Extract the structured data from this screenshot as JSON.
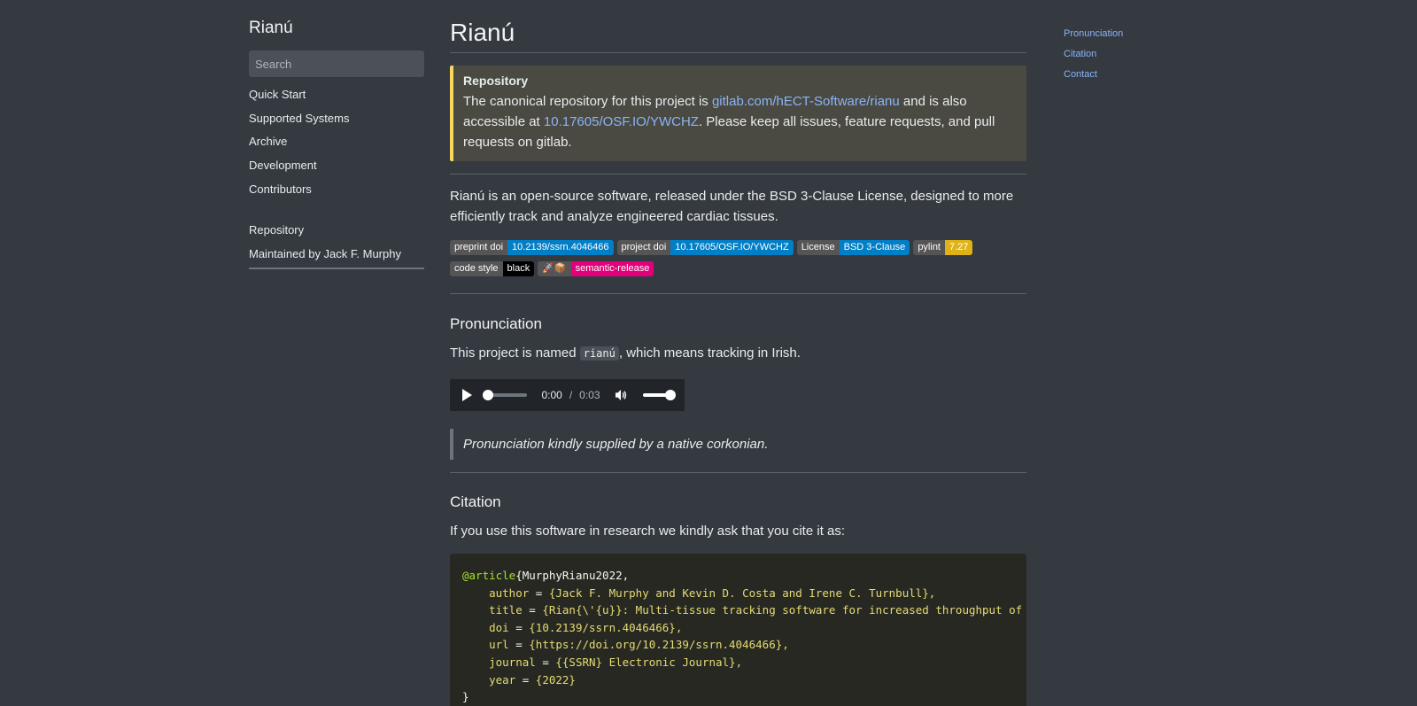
{
  "sidebar": {
    "title": "Rianú",
    "search_placeholder": "Search",
    "nav": [
      "Quick Start",
      "Supported Systems",
      "Archive",
      "Development",
      "Contributors"
    ],
    "links": [
      "Repository",
      "Maintained by Jack F. Murphy"
    ]
  },
  "main": {
    "title": "Rianú",
    "admonition": {
      "title": "Repository",
      "text_1": "The canonical repository for this project is ",
      "link_1": "gitlab.com/hECT-Software/rianu",
      "text_2": " and is also accessible at ",
      "link_2": "10.17605/OSF.IO/YWCHZ",
      "text_3": ". Please keep all issues, feature requests, and pull requests on gitlab."
    },
    "intro": "Rianú is an open-source software, released under the BSD 3-Clause License, designed to more efficiently track and analyze engineered cardiac tissues.",
    "badges": [
      {
        "label": "preprint doi",
        "value": "10.2139/ssrn.4046466",
        "color": "#007ec6"
      },
      {
        "label": "project doi",
        "value": "10.17605/OSF.IO/YWCHZ",
        "color": "#007ec6"
      },
      {
        "label": "License",
        "value": "BSD 3-Clause",
        "color": "#007ec6"
      },
      {
        "label": "pylint",
        "value": "7.27",
        "color": "#dfb317"
      },
      {
        "label": "code style",
        "value": "black",
        "color": "#000000"
      },
      {
        "label": "🚀📦",
        "value": "semantic-release",
        "color": "#e10079"
      }
    ],
    "pronunciation": {
      "heading": "Pronunciation",
      "text_before": "This project is named ",
      "code": "rianú",
      "text_after": ", which means tracking in Irish.",
      "audio": {
        "current": "0:00",
        "separator": "/",
        "duration": "0:03",
        "progress": 0,
        "volume": 1
      },
      "quote": "Pronunciation kindly supplied by a native corkonian."
    },
    "citation": {
      "heading": "Citation",
      "text": "If you use this software in research we kindly ask that you cite it as:",
      "entry_type": "@article",
      "entry_key": "{MurphyRianu2022,",
      "fields": [
        {
          "key": "author",
          "value": "{Jack F. Murphy and Kevin D. Costa and Irene C. Turnbull},"
        },
        {
          "key": "title",
          "value": "{Rian{\\'{u}}: Multi-tissue tracking software for increased throughput of engineered cardiac tissue screening},"
        },
        {
          "key": "doi",
          "value": "{10.2139/ssrn.4046466},"
        },
        {
          "key": "url",
          "value": "{https://doi.org/10.2139/ssrn.4046466},"
        },
        {
          "key": "journal",
          "value": "{{SSRN} Electronic Journal},"
        },
        {
          "key": "year",
          "value": "{2022}"
        }
      ],
      "closing": "}"
    }
  },
  "toc": [
    "Pronunciation",
    "Citation",
    "Contact"
  ]
}
